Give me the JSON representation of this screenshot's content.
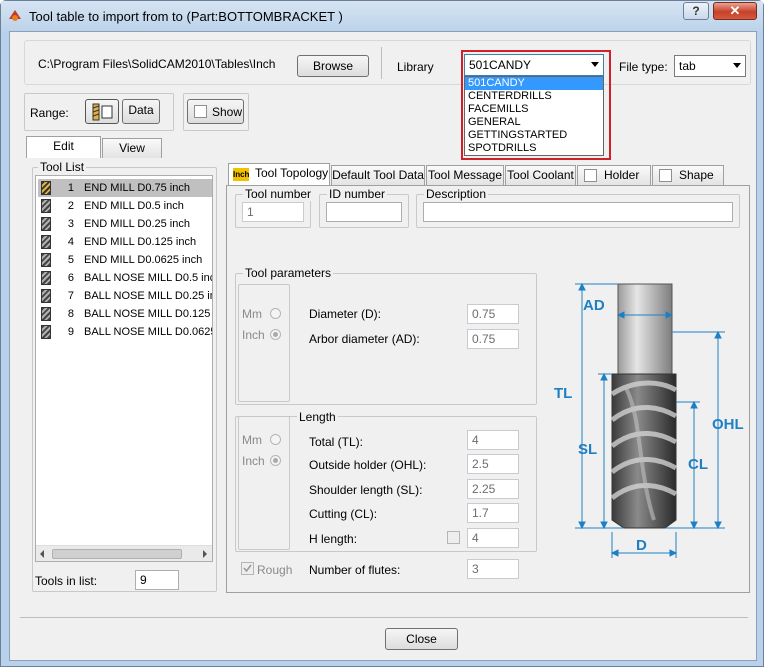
{
  "window": {
    "title": "Tool table to import from to (Part:BOTTOMBRACKET )",
    "help_label": "?",
    "close_label": "✕"
  },
  "path": {
    "value": "C:\\Program Files\\SolidCAM2010\\Tables\\Inch",
    "browse_label": "Browse"
  },
  "library": {
    "label": "Library",
    "selected": "501CANDY",
    "options": [
      "501CANDY",
      "CENTERDRILLS",
      "FACEMILLS",
      "GENERAL",
      "GETTINGSTARTED",
      "SPOTDRILLS"
    ]
  },
  "file_type": {
    "label": "File type:",
    "selected": "tab"
  },
  "range": {
    "label": "Range:",
    "data_label": "Data",
    "show_label": "Show"
  },
  "left_tabs": [
    "Edit",
    "View"
  ],
  "tool_list": {
    "title": "Tool List",
    "items": [
      {
        "num": "1",
        "name": "END MILL  D0.75 inch"
      },
      {
        "num": "2",
        "name": "END MILL  D0.5 inch"
      },
      {
        "num": "3",
        "name": "END MILL  D0.25 inch"
      },
      {
        "num": "4",
        "name": "END MILL  D0.125 inch"
      },
      {
        "num": "5",
        "name": "END MILL  D0.0625 inch"
      },
      {
        "num": "6",
        "name": "BALL NOSE MILL  D0.5 inch"
      },
      {
        "num": "7",
        "name": "BALL NOSE MILL  D0.25 inc"
      },
      {
        "num": "8",
        "name": "BALL NOSE MILL  D0.125 ir"
      },
      {
        "num": "9",
        "name": "BALL NOSE MILL  D0.0625"
      }
    ],
    "count_label": "Tools in list:",
    "count_value": "9"
  },
  "right_tabs": [
    "Tool Topology",
    "Default Tool Data",
    "Tool Message",
    "Tool Coolant",
    "Holder",
    "Shape"
  ],
  "unit_badge": "Inch",
  "tool_number": {
    "label": "Tool number",
    "value": "1"
  },
  "id_number": {
    "label": "ID number",
    "value": ""
  },
  "description": {
    "label": "Description",
    "value": ""
  },
  "tool_params": {
    "title": "Tool parameters",
    "mm": "Mm",
    "inch": "Inch",
    "diameter_label": "Diameter (D):",
    "diameter_value": "0.75",
    "arbor_label": "Arbor diameter (AD):",
    "arbor_value": "0.75"
  },
  "length": {
    "title": "Length",
    "mm": "Mm",
    "inch": "Inch",
    "total_label": "Total (TL):",
    "total_value": "4",
    "ohl_label": "Outside holder (OHL):",
    "ohl_value": "2.5",
    "sl_label": "Shoulder length (SL):",
    "sl_value": "2.25",
    "cl_label": "Cutting (CL):",
    "cl_value": "1.7",
    "h_label": "H length:",
    "h_value": "4"
  },
  "rough_label": "Rough",
  "flutes": {
    "label": "Number of flutes:",
    "value": "3"
  },
  "diagram_labels": {
    "ad": "AD",
    "tl": "TL",
    "sl": "SL",
    "ohl": "OHL",
    "cl": "CL",
    "d": "D"
  },
  "close_label": "Close",
  "colors": {
    "accent_blue": "#1f7fc4",
    "highlight_red": "#d0202a",
    "selection": "#3399ff"
  }
}
